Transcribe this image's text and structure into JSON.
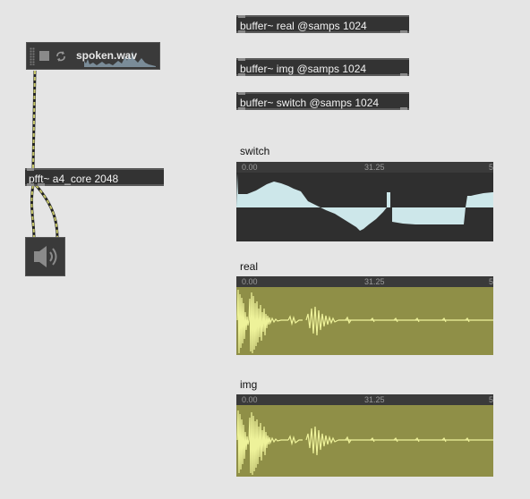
{
  "objects": {
    "buffer_real": "buffer~ real @samps 1024",
    "buffer_img": "buffer~ img @samps 1024",
    "buffer_switch": "buffer~ switch @samps 1024",
    "pfft": "pfft~ a4_core 2048"
  },
  "player": {
    "filename": "spoken.wav"
  },
  "waveforms": [
    {
      "label": "switch",
      "start": "0.00",
      "mid": "31.25",
      "end": "5"
    },
    {
      "label": "real",
      "start": "0.00",
      "mid": "31.25",
      "end": "5"
    },
    {
      "label": "img",
      "start": "0.00",
      "mid": "31.25",
      "end": "5"
    }
  ],
  "colors": {
    "canvas": "#e5e5e5",
    "object_bg": "#333333",
    "patch_cord": "#c8c86a",
    "switch_wave_bg": "#2f2f2f",
    "switch_wave_fill": "#cde7ea",
    "spectrum_bg": "#8f8f47",
    "spectrum_wave": "#eef29a"
  },
  "icons": {
    "player_drag_handle": "grip-icon",
    "player_stop": "stop-square-icon",
    "player_loop": "loop-icon",
    "dac_speaker": "speaker-icon"
  }
}
